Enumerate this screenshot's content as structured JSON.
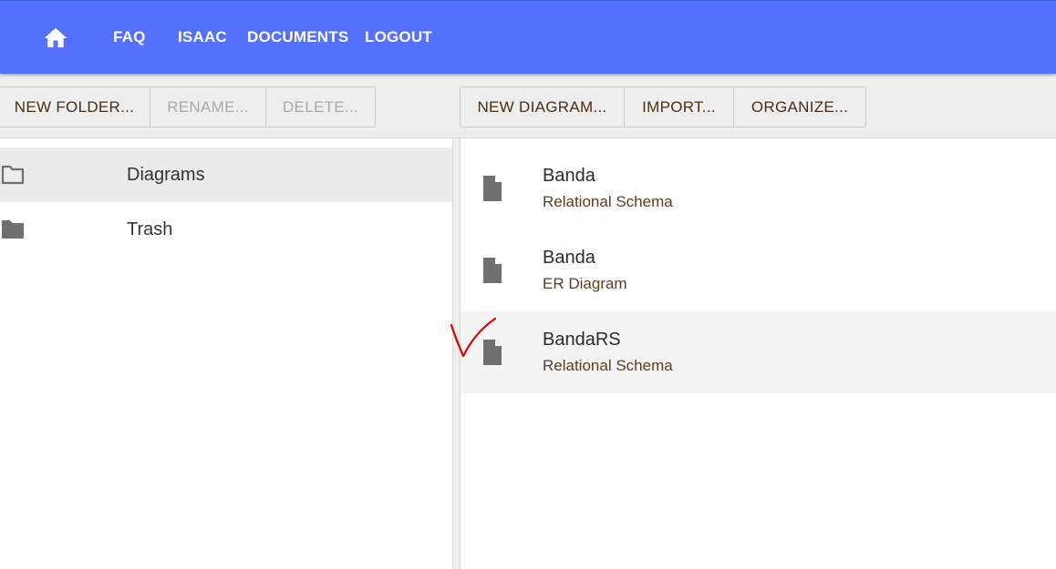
{
  "nav": {
    "home_icon": "home-icon",
    "links": [
      "FAQ",
      "ISAAC",
      "DOCUMENTS",
      "LOGOUT"
    ]
  },
  "folder_toolbar": {
    "new_folder": "NEW FOLDER...",
    "rename": "RENAME...",
    "delete": "DELETE..."
  },
  "diagram_toolbar": {
    "new_diagram": "NEW DIAGRAM...",
    "import": "IMPORT...",
    "organize": "ORGANIZE..."
  },
  "folders": [
    {
      "label": "Diagrams",
      "icon": "folder-outline-icon",
      "selected": true
    },
    {
      "label": "Trash",
      "icon": "folder-filled-icon",
      "selected": false
    }
  ],
  "documents": [
    {
      "title": "Banda",
      "subtitle": "Relational Schema",
      "icon": "document-icon"
    },
    {
      "title": "Banda",
      "subtitle": "ER Diagram",
      "icon": "document-icon"
    },
    {
      "title": "BandaRS",
      "subtitle": "Relational Schema",
      "icon": "document-icon"
    }
  ],
  "colors": {
    "topbar": "#5470fe",
    "toolbar_bg": "#eeeeee",
    "disabled_text": "#a8a8a8",
    "annotation_mark": "#e00000"
  }
}
